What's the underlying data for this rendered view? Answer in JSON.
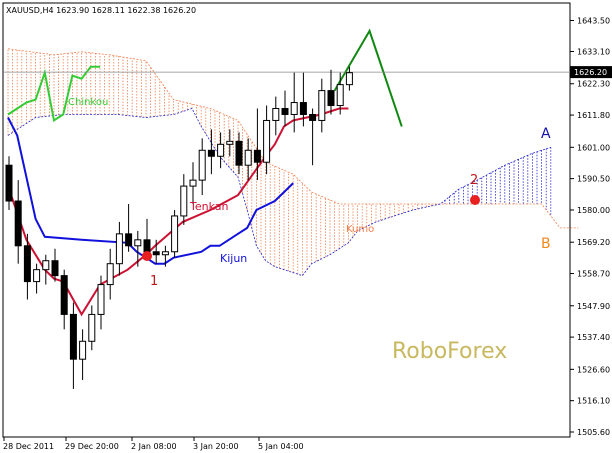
{
  "chart_data": {
    "type": "candlestick",
    "title": "XAUUSD,H4  1623.90 1628.11 1622.38 1626.20",
    "symbol": "XAUUSD,H4",
    "ohlc_header": "1623.90 1628.11 1622.38 1626.20",
    "current_price_label": "1626.20",
    "ylim": [
      1505.6,
      1645
    ],
    "y_ticks": [
      "1643.50",
      "1633.10",
      "1622.30",
      "1611.80",
      "1601.00",
      "1590.50",
      "1580.00",
      "1569.20",
      "1558.70",
      "1547.90",
      "1537.40",
      "1526.60",
      "1516.10",
      "1505.60"
    ],
    "x_ticks": [
      "28 Dec 2011",
      "29 Dec 20:00",
      "2 Jan 08:00",
      "3 Jan 20:00",
      "5 Jan 04:00"
    ],
    "candles": [
      [
        1595,
        1598,
        1580,
        1583
      ],
      [
        1583,
        1590,
        1562,
        1568
      ],
      [
        1568,
        1572,
        1550,
        1556
      ],
      [
        1556,
        1562,
        1552,
        1560
      ],
      [
        1560,
        1565,
        1555,
        1563
      ],
      [
        1563,
        1567,
        1556,
        1558
      ],
      [
        1558,
        1560,
        1540,
        1545
      ],
      [
        1545,
        1549,
        1520,
        1530
      ],
      [
        1530,
        1540,
        1523,
        1536
      ],
      [
        1536,
        1548,
        1533,
        1545
      ],
      [
        1545,
        1558,
        1540,
        1555
      ],
      [
        1555,
        1567,
        1550,
        1562
      ],
      [
        1562,
        1576,
        1558,
        1572
      ],
      [
        1572,
        1582,
        1566,
        1568
      ],
      [
        1568,
        1573,
        1561,
        1570
      ],
      [
        1570,
        1577,
        1564,
        1566
      ],
      [
        1566,
        1570,
        1562,
        1565
      ],
      [
        1565,
        1568,
        1561,
        1566
      ],
      [
        1566,
        1580,
        1564,
        1578
      ],
      [
        1578,
        1592,
        1575,
        1588
      ],
      [
        1588,
        1596,
        1582,
        1590
      ],
      [
        1590,
        1604,
        1585,
        1600
      ],
      [
        1600,
        1607,
        1592,
        1598
      ],
      [
        1598,
        1606,
        1594,
        1602
      ],
      [
        1602,
        1607,
        1598,
        1603
      ],
      [
        1603,
        1606,
        1592,
        1595
      ],
      [
        1595,
        1604,
        1590,
        1600
      ],
      [
        1600,
        1614,
        1590,
        1596
      ],
      [
        1596,
        1615,
        1592,
        1610
      ],
      [
        1610,
        1618,
        1605,
        1614
      ],
      [
        1614,
        1620,
        1608,
        1612
      ],
      [
        1612,
        1626,
        1606,
        1616
      ],
      [
        1616,
        1626,
        1608,
        1612
      ],
      [
        1612,
        1614,
        1595,
        1610
      ],
      [
        1610,
        1624,
        1606,
        1620
      ],
      [
        1620,
        1627,
        1612,
        1615
      ],
      [
        1615,
        1626,
        1612,
        1622
      ],
      [
        1622,
        1628,
        1620,
        1626
      ]
    ],
    "series": [
      {
        "name": "Tenkan",
        "color": "#cc1133"
      },
      {
        "name": "Kijun",
        "color": "#1111dd"
      },
      {
        "name": "Chinkou",
        "color": "#33cc33"
      },
      {
        "name": "Kumo",
        "color": "#f08050"
      }
    ],
    "tenkan": [
      [
        0,
        1588
      ],
      [
        2,
        1570
      ],
      [
        4,
        1560
      ],
      [
        5,
        1557
      ],
      [
        6,
        1556
      ],
      [
        8,
        1545
      ],
      [
        10,
        1555
      ],
      [
        13,
        1560
      ],
      [
        15,
        1565
      ],
      [
        16,
        1568
      ],
      [
        19,
        1576
      ],
      [
        22,
        1580
      ],
      [
        25,
        1585
      ],
      [
        28,
        1598
      ],
      [
        29,
        1602
      ],
      [
        30,
        1608
      ],
      [
        31,
        1610
      ],
      [
        34,
        1612
      ],
      [
        36,
        1614
      ],
      [
        37,
        1614
      ]
    ],
    "kijun": [
      [
        0,
        1611
      ],
      [
        1,
        1605
      ],
      [
        3,
        1577
      ],
      [
        4,
        1571
      ],
      [
        8,
        1570
      ],
      [
        13,
        1569
      ],
      [
        14,
        1566
      ],
      [
        15,
        1564
      ],
      [
        16,
        1562
      ],
      [
        17,
        1562
      ],
      [
        18,
        1564
      ],
      [
        21,
        1566
      ],
      [
        22,
        1568
      ],
      [
        23,
        1568
      ],
      [
        25,
        1572
      ],
      [
        26,
        1574
      ],
      [
        27,
        1580
      ],
      [
        29,
        1583
      ],
      [
        30,
        1586
      ],
      [
        31,
        1589
      ]
    ],
    "chinkou": [
      [
        0,
        1612
      ],
      [
        1,
        1614
      ],
      [
        2,
        1616
      ],
      [
        3,
        1617
      ],
      [
        4,
        1626
      ],
      [
        5,
        1610
      ],
      [
        6,
        1612
      ],
      [
        7,
        1625
      ],
      [
        8,
        1624
      ],
      [
        9,
        1628
      ],
      [
        10,
        1628
      ]
    ],
    "senkou_b": [
      [
        0,
        1634
      ],
      [
        5,
        1632
      ],
      [
        8,
        1633
      ],
      [
        11,
        1632
      ],
      [
        15,
        1630
      ],
      [
        18,
        1617
      ],
      [
        22,
        1614
      ],
      [
        25,
        1610
      ],
      [
        28,
        1596
      ],
      [
        31,
        1592
      ],
      [
        33,
        1586
      ],
      [
        36,
        1582
      ],
      [
        40,
        1582
      ],
      [
        45,
        1582
      ],
      [
        50,
        1582
      ],
      [
        55,
        1582
      ],
      [
        58,
        1582
      ],
      [
        59,
        1578
      ],
      [
        60,
        1574
      ],
      [
        62,
        1574
      ]
    ],
    "senkou_a": [
      [
        0,
        1605
      ],
      [
        3,
        1611
      ],
      [
        6,
        1612
      ],
      [
        9,
        1612
      ],
      [
        12,
        1612
      ],
      [
        15,
        1611
      ],
      [
        18,
        1612
      ],
      [
        20,
        1614
      ],
      [
        21,
        1608
      ],
      [
        23,
        1598
      ],
      [
        25,
        1591
      ],
      [
        26,
        1580
      ],
      [
        27,
        1568
      ],
      [
        28,
        1563
      ],
      [
        29,
        1561
      ],
      [
        30,
        1560
      ],
      [
        32,
        1558
      ],
      [
        33,
        1562
      ],
      [
        35,
        1565
      ],
      [
        37,
        1569
      ],
      [
        38,
        1573
      ],
      [
        40,
        1576
      ],
      [
        44,
        1580
      ],
      [
        47,
        1582
      ],
      [
        49,
        1587
      ],
      [
        51,
        1590
      ],
      [
        54,
        1595
      ],
      [
        57,
        1599
      ],
      [
        59,
        1601
      ]
    ],
    "forecast_zigzag": [
      [
        1620,
        1640,
        1608
      ]
    ],
    "annotations": [
      "1",
      "2",
      "A",
      "B",
      "Tenkan",
      "Kijun",
      "Chinkou",
      "Kumo",
      "RoboForex"
    ]
  }
}
